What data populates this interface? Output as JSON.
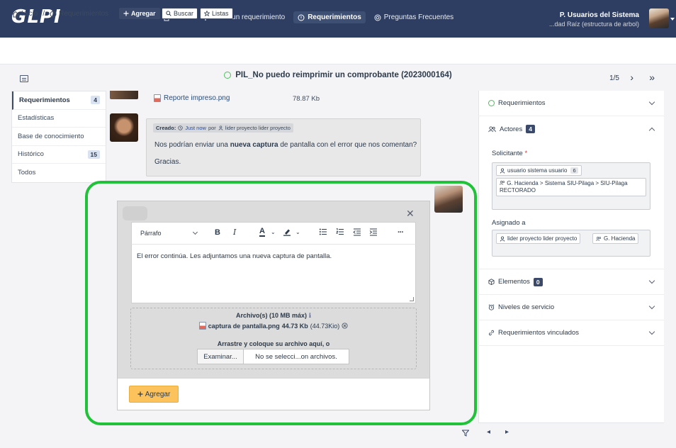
{
  "app": {
    "logo": "GLPI"
  },
  "nav": {
    "items": [
      {
        "label": "Inicio",
        "icon": "home-icon"
      },
      {
        "label": "Crear un requerimiento",
        "icon": "plus-icon"
      },
      {
        "label": "Requerimientos",
        "icon": "alert-circle-icon",
        "active": true
      },
      {
        "label": "Preguntas Frecuentes",
        "icon": "lifebuoy-icon"
      }
    ]
  },
  "user": {
    "name": "P. Usuarios del Sistema",
    "entity": "...dad Raíz (estructura de arbol)"
  },
  "breadcrumb": {
    "home": "Inicio",
    "separator": "/",
    "current": "Requerimientos"
  },
  "actions": {
    "add": "Agregar",
    "search": "Buscar",
    "lists": "Listas"
  },
  "ticket": {
    "title": "PIL_No puedo reimprimir un comprobante (2023000164)",
    "pager": "1/5"
  },
  "left_tabs": [
    {
      "label": "Requerimientos",
      "badge": "4",
      "active": true
    },
    {
      "label": "Estadísticas",
      "badge": ""
    },
    {
      "label": "Base de conocimiento",
      "badge": ""
    },
    {
      "label": "Histórico",
      "badge": "15"
    },
    {
      "label": "Todos",
      "badge": ""
    }
  ],
  "timeline": {
    "document": {
      "name": "Reporte impreso.png",
      "size": "78.87 Kb"
    },
    "followup": {
      "created_label": "Creado:",
      "time": "Just now",
      "by": "por",
      "author": "lider proyecto lider proyecto",
      "text_before": "Nos podrían enviar una ",
      "text_bold": "nueva captura",
      "text_after": " de pantalla con el error que nos comentan?",
      "text2": "Gracias."
    },
    "editor": {
      "format": "Párrafo",
      "content": "El error continúa. Les adjuntamos una nueva captura de pantalla.",
      "files_label": "Archivo(s) (10 MB máx)",
      "file_name": "captura de pantalla.png",
      "file_size": "44.73 Kb",
      "file_size_detail": "(44.73Kio)",
      "drop_hint": "Arrastre y coloque su archivo aquí, o",
      "browse": "Examinar...",
      "no_file": "No se selecci...on archivos.",
      "submit": "Agregar"
    }
  },
  "right_panel": {
    "sections": {
      "requerimientos": "Requerimientos",
      "actores": "Actores",
      "actores_count": "4",
      "elementos": "Elementos",
      "elementos_count": "0",
      "niveles": "Niveles de servicio",
      "vinculados": "Requerimientos vinculados"
    },
    "requester_label": "Solicitante",
    "required_mark": "*",
    "requester_user": "usuario sistema usuario",
    "requester_user_count": "6",
    "requester_group": "G. Hacienda > Sistema SIU-Pilaga > SIU-Pilaga RECTORADO",
    "assigned_label": "Asignado a",
    "assigned_user": "lider proyecto lider proyecto",
    "assigned_group": "G. Hacienda"
  },
  "colors": {
    "topbar": "#2e3e62",
    "highlight_frame": "#22c13a",
    "submit_button": "#fcc35c"
  }
}
